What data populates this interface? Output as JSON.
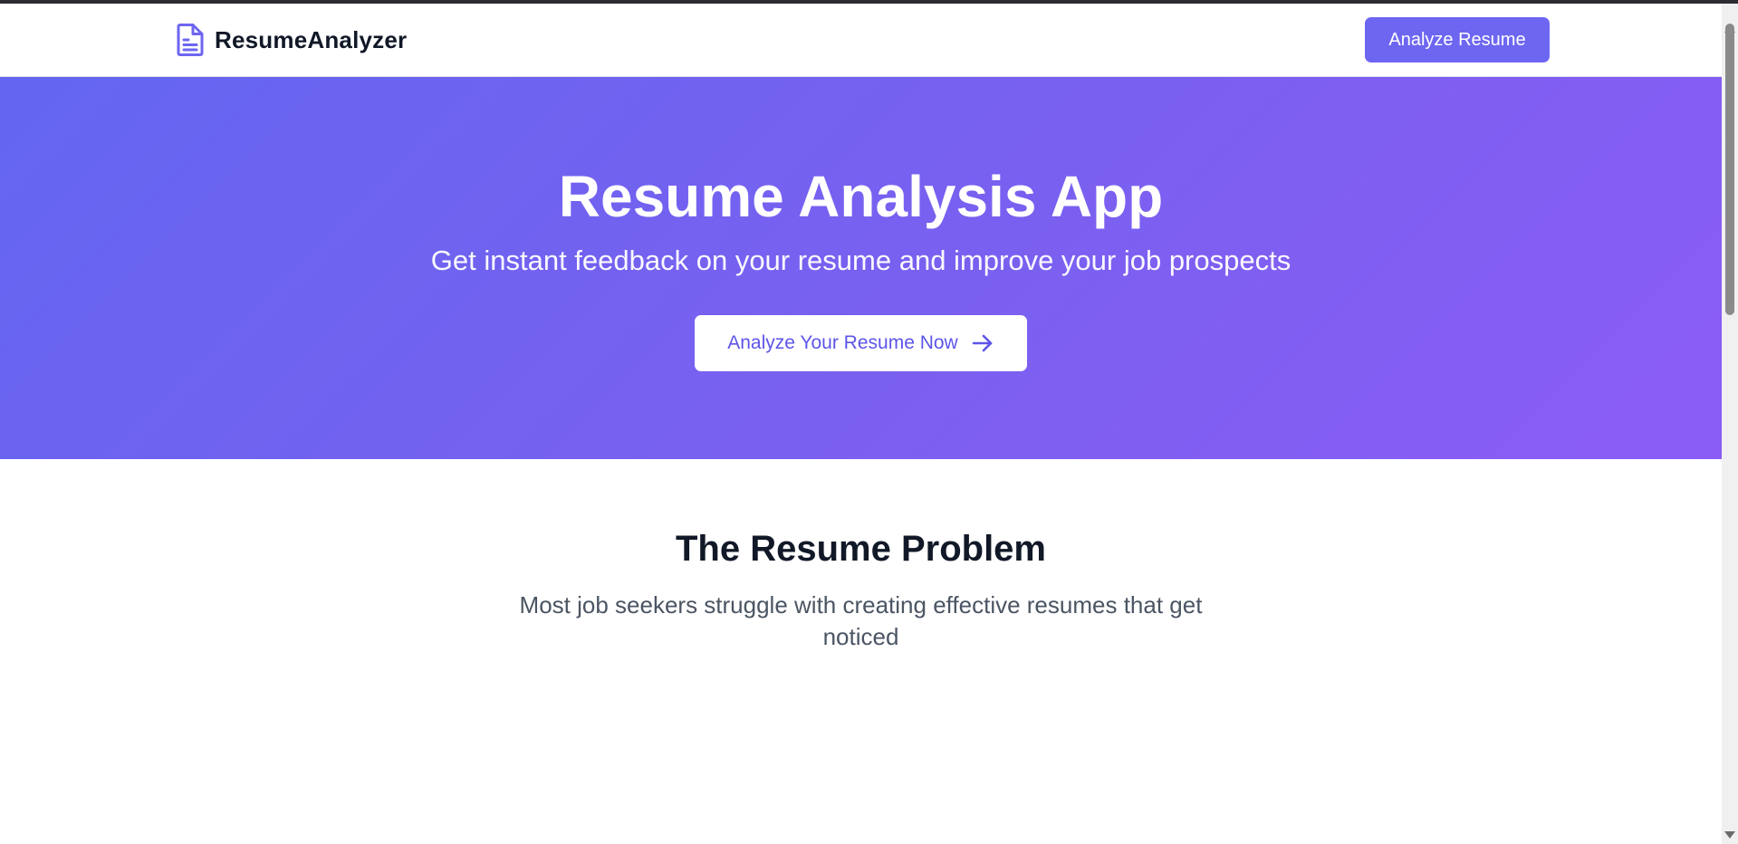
{
  "header": {
    "brand_name": "ResumeAnalyzer",
    "brand_icon": "document-icon",
    "cta_label": "Analyze Resume"
  },
  "hero": {
    "title": "Resume Analysis App",
    "subtitle": "Get instant feedback on your resume and improve your job prospects",
    "cta_label": "Analyze Your Resume Now",
    "cta_icon": "arrow-right-icon"
  },
  "problem_section": {
    "title": "The Resume Problem",
    "text": "Most job seekers struggle with creating effective resumes that get noticed"
  },
  "colors": {
    "accent": "#6d66f1",
    "hero_gradient_start": "#6366f1",
    "hero_gradient_end": "#8b5cf6",
    "heading": "#111827",
    "body_text": "#4b5563"
  }
}
